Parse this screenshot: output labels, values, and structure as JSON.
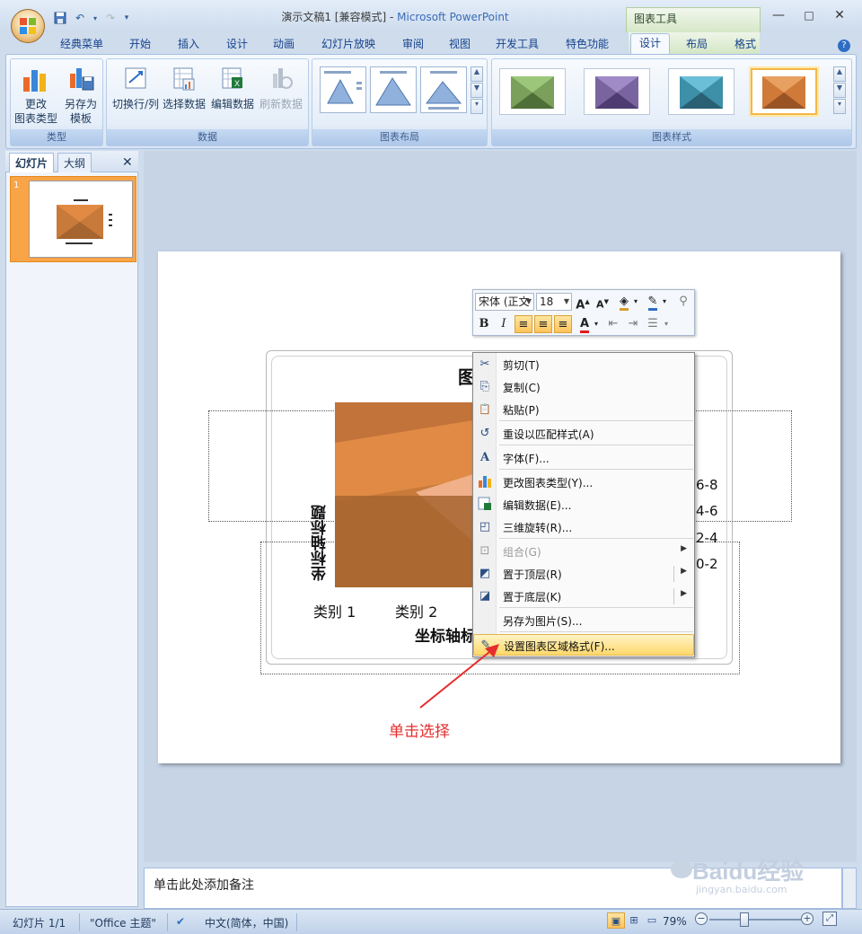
{
  "window": {
    "title_doc": "演示文稿1 [兼容模式] - ",
    "title_app": "Microsoft PowerPoint",
    "context_tool": "图表工具",
    "min": "—",
    "max": "□",
    "close": "✕"
  },
  "tabs": [
    "经典菜单",
    "开始",
    "插入",
    "设计",
    "动画",
    "幻灯片放映",
    "审阅",
    "视图",
    "开发工具",
    "特色功能",
    "设计",
    "布局",
    "格式"
  ],
  "ribbon": {
    "type_group": {
      "label": "类型",
      "change_type_line1": "更改",
      "change_type_line2": "图表类型",
      "save_template_line1": "另存为",
      "save_template_line2": "模板"
    },
    "data_group": {
      "label": "数据",
      "switch": "切换行/列",
      "select": "选择数据",
      "edit": "编辑数据",
      "refresh": "刷新数据"
    },
    "layout_group": {
      "label": "图表布局"
    },
    "style_group": {
      "label": "图表样式"
    }
  },
  "left_panel": {
    "tab_slides": "幻灯片",
    "tab_outline": "大纲",
    "slide_number": "1"
  },
  "chart": {
    "title_visible": "图",
    "y_axis_title": "坐标轴标题",
    "x_axis_title_visible": "坐标轴标",
    "categories_visible": [
      "类别 1",
      "类别 2"
    ],
    "legend": [
      "6-8",
      "4-6",
      "2-4",
      "0-2"
    ]
  },
  "mini_toolbar": {
    "font_name": "宋体 (正文",
    "font_size": "18",
    "bold": "B",
    "italic": "I",
    "font_color_letter": "A"
  },
  "context_menu": [
    {
      "label": "剪切(T)",
      "icon": "scissors-icon",
      "glyph": "✂"
    },
    {
      "label": "复制(C)",
      "icon": "copy-icon",
      "glyph": "⎘"
    },
    {
      "label": "粘贴(P)",
      "icon": "paste-icon",
      "glyph": "📋"
    },
    {
      "label": "重设以匹配样式(A)",
      "icon": "reset-style-icon",
      "glyph": "↺"
    },
    {
      "label": "字体(F)...",
      "icon": "font-icon",
      "glyph": "A"
    },
    {
      "label": "更改图表类型(Y)...",
      "icon": "chart-type-icon",
      "glyph": "▮"
    },
    {
      "label": "编辑数据(E)...",
      "icon": "edit-data-icon",
      "glyph": "▦"
    },
    {
      "label": "三维旋转(R)...",
      "icon": "rotate-3d-icon",
      "glyph": "◰"
    },
    {
      "label": "组合(G)",
      "icon": "group-icon",
      "glyph": "⊡"
    },
    {
      "label": "置于顶层(R)",
      "icon": "bring-front-icon",
      "glyph": "◩"
    },
    {
      "label": "置于底层(K)",
      "icon": "send-back-icon",
      "glyph": "◪"
    },
    {
      "label": "另存为图片(S)...",
      "icon": "save-picture-icon",
      "glyph": ""
    },
    {
      "label": "设置图表区域格式(F)...",
      "icon": "format-chart-area-icon",
      "glyph": "✎"
    }
  ],
  "annotation": "单击选择",
  "notes_placeholder": "单击此处添加备注",
  "status": {
    "slide": "幻灯片 1/1",
    "theme": "\"Office 主题\"",
    "language": "中文(简体，中国)",
    "zoom": "79%"
  },
  "watermark": {
    "brand": "Baidu经验",
    "url": "jingyan.baidu.com"
  },
  "colors": {
    "chart_dark": "#a6652f",
    "chart_mid": "#c87a3b",
    "chart_light": "#e28a44",
    "highlight": "#ffd86b",
    "annotation": "#e52d2d"
  }
}
